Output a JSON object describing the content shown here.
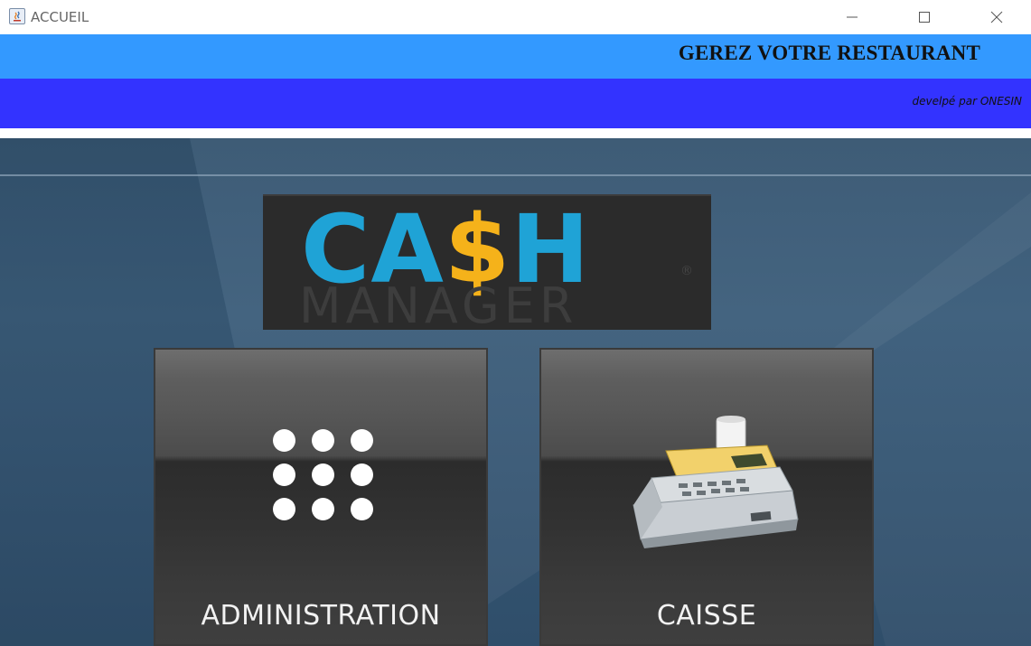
{
  "window": {
    "title": "ACCUEIL",
    "controls": {
      "minimize": "—",
      "maximize": "☐",
      "close": "✕"
    }
  },
  "header": {
    "title": "GEREZ VOTRE RESTAURANT",
    "credit": "develpé par ONESIN"
  },
  "logo": {
    "cash_prefix": "CA",
    "cash_dollar": "$",
    "cash_suffix": "H",
    "manager": "MANAGER",
    "registered": "®"
  },
  "tiles": {
    "administration": {
      "label": "ADMINISTRATION",
      "icon": "dots-grid-icon"
    },
    "caisse": {
      "label": "CAISSE",
      "icon": "cash-register-icon"
    }
  },
  "colors": {
    "banner_top": "#3399ff",
    "banner_bottom": "#3333ff",
    "logo_blue": "#1fa3d6",
    "logo_gold": "#f5b21a"
  }
}
